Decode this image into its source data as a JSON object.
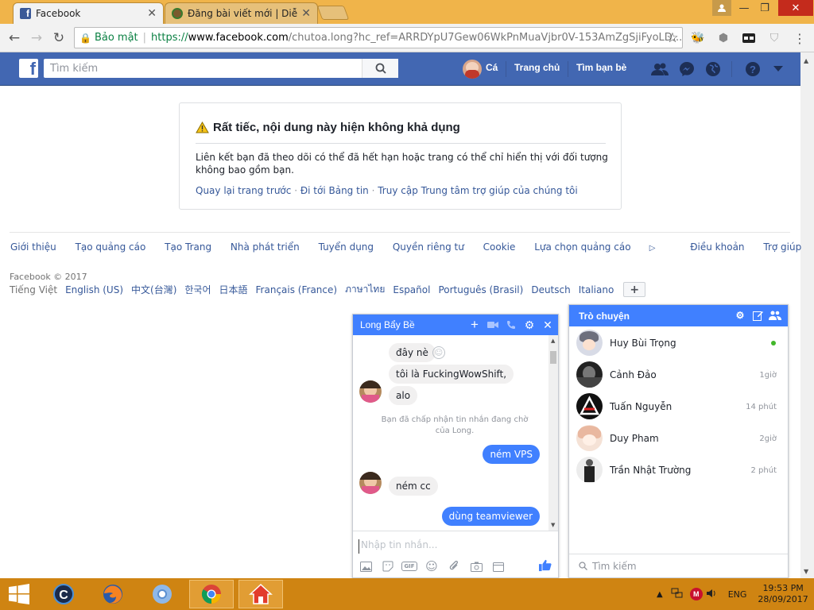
{
  "browser": {
    "tabs": [
      {
        "title": "Facebook",
        "active": true,
        "icon": "facebook-favicon"
      },
      {
        "title": "Đăng bài viết mới | Diễn đ",
        "active": false,
        "icon": "forum-favicon"
      }
    ],
    "address": {
      "secure_label": "Bảo mật",
      "scheme": "https://",
      "host": "www.facebook.com",
      "path": "/chutoa.long?hc_ref=ARRDYpU7Gew06WkPnMuaVjbr0V-153AmZgSjiFyoLD..."
    }
  },
  "fb": {
    "search_placeholder": "Tìm kiếm",
    "user_name": "Cá",
    "nav_home": "Trang chủ",
    "nav_find_friends": "Tìm bạn bè",
    "brand_color": "#4267b2"
  },
  "notice": {
    "title": "Rất tiếc, nội dung này hiện không khả dụng",
    "body": "Liên kết bạn đã theo dõi có thể đã hết hạn hoặc trang có thể chỉ hiển thị với đối tượng không bao gồm bạn.",
    "links": [
      "Quay lại trang trước",
      "Đi tới Bảng tin",
      "Truy cập Trung tâm trợ giúp của chúng tôi"
    ]
  },
  "footer": {
    "links": [
      "Giới thiệu",
      "Tạo quảng cáo",
      "Tạo Trang",
      "Nhà phát triển",
      "Tuyển dụng",
      "Quyền riêng tư",
      "Cookie",
      "Lựa chọn quảng cáo",
      "Điều khoản",
      "Trợ giúp"
    ],
    "copyright": "Facebook © 2017",
    "current_language": "Tiếng Việt",
    "languages": [
      "English (US)",
      "中文(台灣)",
      "한국어",
      "日本語",
      "Français (France)",
      "ภาษาไทย",
      "Español",
      "Português (Brasil)",
      "Deutsch",
      "Italiano"
    ],
    "more_label": "+"
  },
  "chat": {
    "contact": "Long Bẩy Bề",
    "messages": [
      {
        "text": "đây nè",
        "dir": "in"
      },
      {
        "text": "tôi là FuckingWowShift,",
        "dir": "in"
      },
      {
        "text": "alo",
        "dir": "in"
      },
      {
        "text": "Bạn đã chấp nhận tin nhắn đang chờ của Long.",
        "dir": "system"
      },
      {
        "text": "ném VPS",
        "dir": "out"
      },
      {
        "text": "ném cc",
        "dir": "in"
      },
      {
        "text": "dùng teamviewer",
        "dir": "out"
      }
    ],
    "input_placeholder": "Nhập tin nhắn..."
  },
  "buddy": {
    "title": "Trò chuyện",
    "contacts": [
      {
        "name": "Huy Bùi Trọng",
        "time": "",
        "online": true
      },
      {
        "name": "Cảnh Đảo",
        "time": "1giờ",
        "online": false
      },
      {
        "name": "Tuấn Nguyễn",
        "time": "14 phút",
        "online": false
      },
      {
        "name": "Duy Pham",
        "time": "2giờ",
        "online": false
      },
      {
        "name": "Trần Nhật Trường",
        "time": "2 phút",
        "online": false
      }
    ],
    "search_placeholder": "Tìm kiếm"
  },
  "taskbar": {
    "lang": "ENG",
    "time": "19:53 PM",
    "date": "28/09/2017"
  }
}
